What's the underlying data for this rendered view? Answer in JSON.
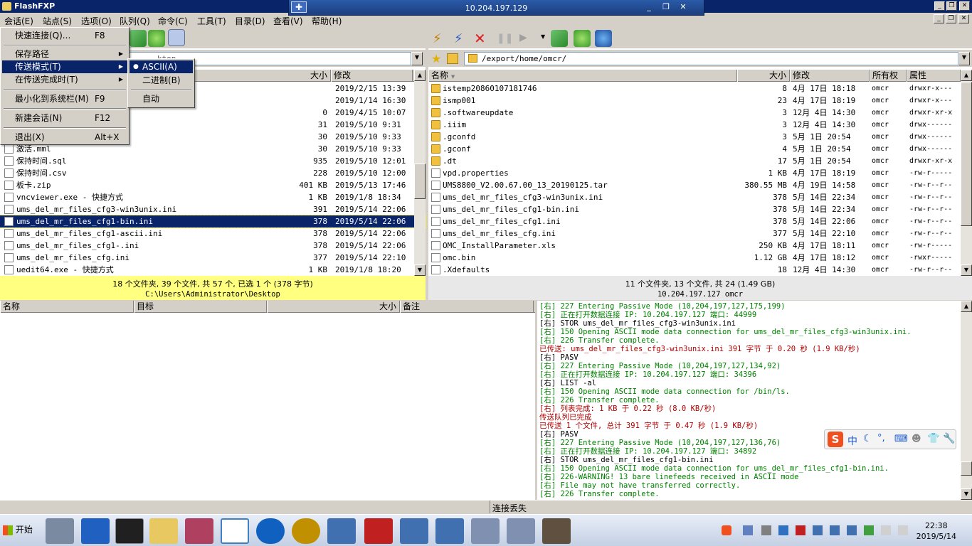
{
  "window": {
    "title": "FlashFXP"
  },
  "rdp": {
    "host": "10.204.197.129"
  },
  "menubar": [
    "会话(E)",
    "站点(S)",
    "选项(O)",
    "队列(Q)",
    "命令(C)",
    "工具(T)",
    "目录(D)",
    "查看(V)",
    "帮助(H)"
  ],
  "session_menu": {
    "quick_connect": "快速连接(Q)...",
    "quick_connect_key": "F8",
    "save_path": "保存路径",
    "transfer_mode": "传送模式(T)",
    "on_complete": "在传送完成时(T)",
    "minimize_tray": "最小化到系统栏(M)",
    "minimize_tray_key": "F9",
    "new_session": "新建会话(N)",
    "new_session_key": "F12",
    "exit": "退出(X)",
    "exit_key": "Alt+X"
  },
  "transfer_submenu": {
    "ascii": "ASCII(A)",
    "binary": "二进制(B)",
    "auto": "自动"
  },
  "left": {
    "path_partial": "...ktop",
    "columns": {
      "size": "大小",
      "modified": "修改"
    },
    "rows": [
      {
        "name": "",
        "size": "",
        "date": "2019/2/15 13:39",
        "icon": "folder"
      },
      {
        "name": "",
        "size": "",
        "date": "2019/1/14 16:30",
        "icon": "folder"
      },
      {
        "name": "",
        "size": "0",
        "date": "2019/4/15 10:07",
        "icon": "file"
      },
      {
        "name": "",
        "size": "31",
        "date": "2019/5/10 9:31",
        "icon": "file"
      },
      {
        "name": "",
        "size": "30",
        "date": "2019/5/10 9:33",
        "icon": "file"
      },
      {
        "name": "激活.mml",
        "size": "30",
        "date": "2019/5/10 9:33",
        "icon": "file"
      },
      {
        "name": "保持时间.sql",
        "size": "935",
        "date": "2019/5/10 12:01",
        "icon": "file"
      },
      {
        "name": "保持时间.csv",
        "size": "228",
        "date": "2019/5/10 12:00",
        "icon": "file"
      },
      {
        "name": "板卡.zip",
        "size": "401 KB",
        "date": "2019/5/13 17:46",
        "icon": "file"
      },
      {
        "name": "vncviewer.exe - 快捷方式",
        "size": "1 KB",
        "date": "2019/1/8 18:34",
        "icon": "file"
      },
      {
        "name": "ums_del_mr_files_cfg3-win3unix.ini",
        "size": "391",
        "date": "2019/5/14 22:06",
        "icon": "file"
      },
      {
        "name": "ums_del_mr_files_cfg1-bin.ini",
        "size": "378",
        "date": "2019/5/14 22:06",
        "icon": "file",
        "selected": true
      },
      {
        "name": "ums_del_mr_files_cfg1-ascii.ini",
        "size": "378",
        "date": "2019/5/14 22:06",
        "icon": "file"
      },
      {
        "name": "ums_del_mr_files_cfg1-.ini",
        "size": "378",
        "date": "2019/5/14 22:06",
        "icon": "file"
      },
      {
        "name": "ums_del_mr_files_cfg.ini",
        "size": "377",
        "date": "2019/5/14 22:10",
        "icon": "file"
      },
      {
        "name": "uedit64.exe - 快捷方式",
        "size": "1 KB",
        "date": "2019/1/8 18:20",
        "icon": "file"
      }
    ],
    "status_line1": "18 个文件夹, 39 个文件, 共 57 个, 已选 1 个 (378 字节)",
    "status_line2": "C:\\Users\\Administrator\\Desktop"
  },
  "right": {
    "path": "/export/home/omcr/",
    "columns": {
      "name": "名称",
      "size": "大小",
      "modified": "修改",
      "owner": "所有权",
      "attr": "属性"
    },
    "rows": [
      {
        "name": "istemp20860107181746",
        "size": "8",
        "date": "4月 17日 18:18",
        "owner": "omcr",
        "attr": "drwxr-x---",
        "icon": "folder"
      },
      {
        "name": "ismp001",
        "size": "23",
        "date": "4月 17日 18:19",
        "owner": "omcr",
        "attr": "drwxr-x---",
        "icon": "folder"
      },
      {
        "name": ".softwareupdate",
        "size": "3",
        "date": "12月 4日 14:30",
        "owner": "omcr",
        "attr": "drwxr-xr-x",
        "icon": "folder"
      },
      {
        "name": ".iiim",
        "size": "3",
        "date": "12月 4日 14:30",
        "owner": "omcr",
        "attr": "drwx------",
        "icon": "folder"
      },
      {
        "name": ".gconfd",
        "size": "3",
        "date": "5月 1日 20:54",
        "owner": "omcr",
        "attr": "drwx------",
        "icon": "folder"
      },
      {
        "name": ".gconf",
        "size": "4",
        "date": "5月 1日 20:54",
        "owner": "omcr",
        "attr": "drwx------",
        "icon": "folder"
      },
      {
        "name": ".dt",
        "size": "17",
        "date": "5月 1日 20:54",
        "owner": "omcr",
        "attr": "drwxr-xr-x",
        "icon": "folder"
      },
      {
        "name": "vpd.properties",
        "size": "1 KB",
        "date": "4月 17日 18:19",
        "owner": "omcr",
        "attr": "-rw-r-----",
        "icon": "file"
      },
      {
        "name": "UMS8800_V2.00.67.00_13_20190125.tar",
        "size": "380.55 MB",
        "date": "4月 19日 14:58",
        "owner": "omcr",
        "attr": "-rw-r--r--",
        "icon": "file"
      },
      {
        "name": "ums_del_mr_files_cfg3-win3unix.ini",
        "size": "378",
        "date": "5月 14日 22:34",
        "owner": "omcr",
        "attr": "-rw-r--r--",
        "icon": "file"
      },
      {
        "name": "ums_del_mr_files_cfg1-bin.ini",
        "size": "378",
        "date": "5月 14日 22:34",
        "owner": "omcr",
        "attr": "-rw-r--r--",
        "icon": "file"
      },
      {
        "name": "ums_del_mr_files_cfg1.ini",
        "size": "378",
        "date": "5月 14日 22:06",
        "owner": "omcr",
        "attr": "-rw-r--r--",
        "icon": "file"
      },
      {
        "name": "ums_del_mr_files_cfg.ini",
        "size": "377",
        "date": "5月 14日 22:10",
        "owner": "omcr",
        "attr": "-rw-r--r--",
        "icon": "file"
      },
      {
        "name": "OMC_InstallParameter.xls",
        "size": "250 KB",
        "date": "4月 17日 18:11",
        "owner": "omcr",
        "attr": "-rw-r-----",
        "icon": "file"
      },
      {
        "name": "omc.bin",
        "size": "1.12 GB",
        "date": "4月 17日 18:12",
        "owner": "omcr",
        "attr": "-rwxr-----",
        "icon": "file"
      },
      {
        "name": ".Xdefaults",
        "size": "18",
        "date": "12月 4日 14:30",
        "owner": "omcr",
        "attr": "-rw-r--r--",
        "icon": "file"
      }
    ],
    "status_line1": "11 个文件夹, 13 个文件, 共 24 (1.49 GB)",
    "status_line2": "10.204.197.127 omcr"
  },
  "queue": {
    "columns": {
      "name": "名称",
      "target": "目标",
      "size": "大小",
      "note": "备注"
    }
  },
  "log": [
    {
      "t": "[右] 227 Entering Passive Mode (10,204,197,127,175,199)",
      "c": "green"
    },
    {
      "t": "[右] 正在打开数据连接 IP: 10.204.197.127 端口: 44999",
      "c": "green"
    },
    {
      "t": "[右] STOR ums_del_mr_files_cfg3-win3unix.ini",
      "c": "black"
    },
    {
      "t": "[右] 150 Opening ASCII mode data connection for ums_del_mr_files_cfg3-win3unix.ini.",
      "c": "green"
    },
    {
      "t": "[右] 226 Transfer complete.",
      "c": "green"
    },
    {
      "t": "已传送: ums_del_mr_files_cfg3-win3unix.ini 391 字节 于 0.20 秒 (1.9 KB/秒)",
      "c": "red"
    },
    {
      "t": "[右] PASV",
      "c": "black"
    },
    {
      "t": "[右] 227 Entering Passive Mode (10,204,197,127,134,92)",
      "c": "green"
    },
    {
      "t": "[右] 正在打开数据连接 IP: 10.204.197.127 端口: 34396",
      "c": "green"
    },
    {
      "t": "[右] LIST -al",
      "c": "black"
    },
    {
      "t": "[右] 150 Opening ASCII mode data connection for /bin/ls.",
      "c": "green"
    },
    {
      "t": "[右] 226 Transfer complete.",
      "c": "green"
    },
    {
      "t": "[右] 列表完成: 1 KB 于 0.22 秒 (8.0 KB/秒)",
      "c": "red"
    },
    {
      "t": "传送队列已完成",
      "c": "red"
    },
    {
      "t": "已传送 1 个文件, 总计 391 字节 于 0.47 秒 (1.9 KB/秒)",
      "c": "red"
    },
    {
      "t": "[右] PASV",
      "c": "black"
    },
    {
      "t": "[右] 227 Entering Passive Mode (10,204,197,127,136,76)",
      "c": "green"
    },
    {
      "t": "[右] 正在打开数据连接 IP: 10.204.197.127 端口: 34892",
      "c": "green"
    },
    {
      "t": "[右] STOR ums_del_mr_files_cfg1-bin.ini",
      "c": "black"
    },
    {
      "t": "[右] 150 Opening ASCII mode data connection for ums_del_mr_files_cfg1-bin.ini.",
      "c": "green"
    },
    {
      "t": "[右] 226-WARNING! 13 bare linefeeds received in ASCII mode",
      "c": "green"
    },
    {
      "t": "[右]     File may not have transferred correctly.",
      "c": "green"
    },
    {
      "t": "[右] 226 Transfer complete.",
      "c": "green"
    }
  ],
  "statusbar": {
    "text": "连接丢失"
  },
  "ime": {
    "label": "中"
  },
  "taskbar": {
    "start": "开始",
    "time": "22:38",
    "date": "2019/5/14"
  }
}
